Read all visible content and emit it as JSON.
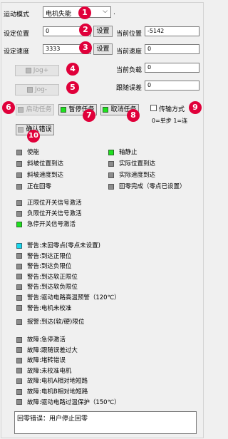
{
  "motion": {
    "mode_label": "运动模式",
    "mode_value": "电机失能",
    "mode_suffix": ".",
    "set_position_label": "设定位置",
    "set_position_value": "0",
    "set_speed_label": "设定速度",
    "set_speed_value": "3333",
    "set_button": "设置",
    "current_position_label": "当前位置",
    "current_position_value": "-5142",
    "current_speed_label": "当前速度",
    "current_speed_value": "0",
    "current_load_label": "当前负载",
    "current_load_value": "0",
    "follow_error_label": "跟随误差",
    "follow_error_value": "0"
  },
  "jog": {
    "plus": "Jog+",
    "minus": "Jog-"
  },
  "tasks": {
    "start": "启动任务",
    "pause": "暂停任务",
    "cancel": "取消任务",
    "transfer_label": "传输方式",
    "transfer_hint": "0=单步 1=连",
    "confirm_error": "确认错误"
  },
  "markers": [
    "1",
    "2",
    "3",
    "4",
    "5",
    "6",
    "7",
    "8",
    "9",
    "10"
  ],
  "status_rows": [
    {
      "left": {
        "text": "使能",
        "color": "gray"
      },
      "right": {
        "text": "轴静止",
        "color": "green"
      }
    },
    {
      "left": {
        "text": "斜坡位置到达",
        "color": "gray"
      },
      "right": {
        "text": "实际位置到达",
        "color": "gray"
      }
    },
    {
      "left": {
        "text": "斜坡速度到达",
        "color": "gray"
      },
      "right": {
        "text": "实际速度到达",
        "color": "gray"
      }
    },
    {
      "left": {
        "text": "正在回零",
        "color": "gray"
      },
      "right": {
        "text": "回零完成（零点已设置）",
        "color": "gray"
      }
    }
  ],
  "limit_group": [
    {
      "text": "正限位开关信号激活",
      "color": "gray"
    },
    {
      "text": "负限位开关信号激活",
      "color": "gray"
    },
    {
      "text": "急停开关信号激活",
      "color": "green"
    }
  ],
  "warning_group": [
    {
      "text": "警告:未回零点(零点未设置)",
      "color": "cyan"
    },
    {
      "text": "警告:到达正限位",
      "color": "gray"
    },
    {
      "text": "警告:到达负限位",
      "color": "gray"
    },
    {
      "text": "警告:到达软正限位",
      "color": "gray"
    },
    {
      "text": "警告:到达软负限位",
      "color": "gray"
    },
    {
      "text": "警告:驱动电路高温预警（120℃）",
      "color": "gray"
    },
    {
      "text": "警告:电机未校准",
      "color": "gray"
    }
  ],
  "alarm": {
    "text": "报警:到达(软/硬)限位",
    "color": "gray"
  },
  "fault_group": [
    {
      "text": "故障:急停激活",
      "color": "gray"
    },
    {
      "text": "故障:跟随误差过大",
      "color": "gray"
    },
    {
      "text": "故障:堵转错误",
      "color": "gray"
    },
    {
      "text": "故障:未校准电机",
      "color": "gray"
    },
    {
      "text": "故障:电机A相对地短路",
      "color": "gray"
    },
    {
      "text": "故障:电机B相对地短路",
      "color": "gray"
    },
    {
      "text": "故障:驱动电路过温保护（150℃）",
      "color": "gray"
    }
  ],
  "message": "回零错误：用户停止回零",
  "colors": {
    "accent_marker": "#e0003a",
    "green": "#1fe01f",
    "cyan": "#18d8ec",
    "gray": "#8c8c8c"
  }
}
